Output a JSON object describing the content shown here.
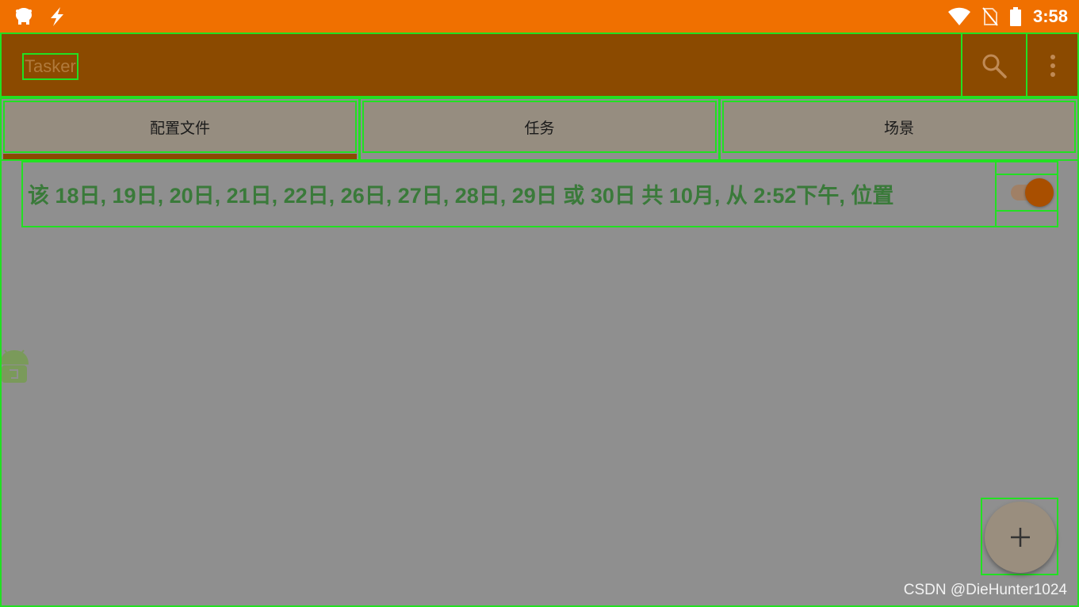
{
  "status_bar": {
    "time": "3:58",
    "left_icons": [
      "notification-app-icon",
      "lightning-icon"
    ],
    "right_icons": [
      "wifi-icon",
      "no-sim-icon",
      "battery-icon"
    ]
  },
  "app_bar": {
    "title": "Tasker",
    "actions": [
      "search-icon",
      "more-vert-icon"
    ]
  },
  "tabs": [
    {
      "label": "配置文件",
      "selected": true
    },
    {
      "label": "任务",
      "selected": false
    },
    {
      "label": "场景",
      "selected": false
    }
  ],
  "profiles": [
    {
      "text": "该 18日, 19日, 20日, 21日, 22日, 26日, 27日, 28日, 29日 或 30日 共 10月, 从  2:52下午, 位置",
      "enabled": true
    }
  ],
  "fab": {
    "icon": "plus-icon"
  },
  "watermark": "CSDN @DieHunter1024",
  "colors": {
    "status_bar": "#f07000",
    "app_bar": "#8b4a00",
    "accent": "#a94f00",
    "highlight_border": "#22e022",
    "profile_text": "#3a7a3a"
  }
}
